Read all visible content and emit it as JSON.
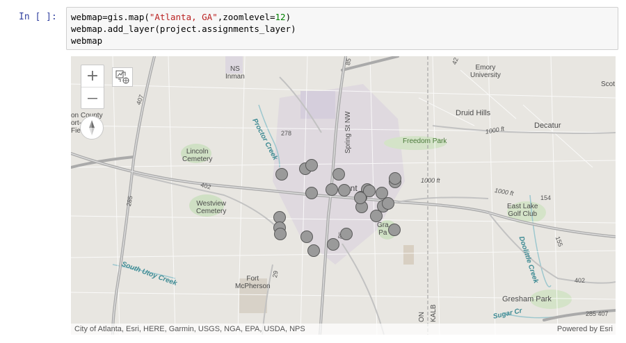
{
  "notebook": {
    "prompt": "In [  ]:",
    "code": {
      "line1": {
        "pre": "webmap=gis.map(",
        "str": "\"Atlanta, GA\"",
        "mid": ",zoomlevel=",
        "num": "12",
        "post": ")"
      },
      "line2": "webmap.add_layer(project.assignments_layer)",
      "line3": "webmap"
    }
  },
  "map": {
    "zoom_in_label": "+",
    "zoom_out_label": "—",
    "labels": {
      "ns_inman": "NS\nInman",
      "emory": "Emory\nUniversity",
      "scott": "Scot",
      "druid_hills": "Druid Hills",
      "decatur": "Decatur",
      "lincoln": "Lincoln\nCemetery",
      "freedom_park": "Freedom Park",
      "proctor_creek": "Proctor Creek",
      "spring_st": "Spring St NW",
      "westview": "Westview\nCemetery",
      "east_lake": "East Lake\nGolf Club",
      "doolittle": "Doolittle Creek",
      "south_utoy": "South Utoy Creek",
      "fort_mcpherson": "Fort\nMcPherson",
      "gresham_park": "Gresham Park",
      "sugar_creek": "Sugar Cr",
      "atlanta_partial": "ant",
      "grant_partial": "Gra\nPa",
      "county": "on County\nort-\nFie",
      "elev_1000_a": "1000 ft",
      "elev_1000_b": "1000 ft",
      "elev_1000_c": "1000 ft",
      "vertical_1": "ON",
      "vertical_2": "KALB"
    },
    "road_shields": {
      "r407": "407",
      "r278": "278",
      "r402_w": "402",
      "r285_w": "285",
      "r29": "29",
      "r154": "154",
      "r155": "155",
      "r402_e": "402",
      "r285_407": "285 407",
      "r42": "42",
      "r85": "85",
      "r85b": "85"
    },
    "attribution": "City of Atlanta, Esri, HERE, Garmin, USGS, NGA, EPA, USDA, NPS",
    "powered_by": "Powered by Esri",
    "marker_style": {
      "fill": "#9a9a9a",
      "stroke": "#585858"
    },
    "markers": [
      "assignment-1",
      "assignment-2",
      "assignment-3",
      "assignment-4",
      "assignment-5",
      "assignment-6",
      "assignment-7",
      "assignment-8",
      "assignment-9",
      "assignment-10",
      "assignment-11",
      "assignment-12",
      "assignment-13",
      "assignment-14",
      "assignment-15",
      "assignment-16",
      "assignment-17",
      "assignment-18",
      "assignment-19",
      "assignment-20",
      "assignment-21",
      "assignment-22",
      "assignment-23",
      "assignment-24",
      "assignment-25",
      "assignment-26"
    ]
  }
}
